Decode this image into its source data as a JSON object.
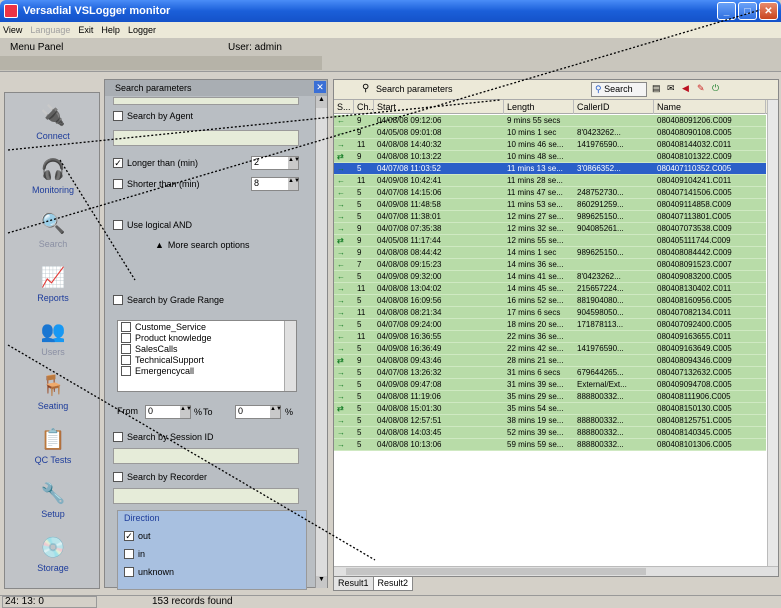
{
  "window": {
    "title": "Versadial VSLogger monitor"
  },
  "menu": {
    "items": [
      "View",
      "Language",
      "Exit",
      "Help",
      "Logger"
    ],
    "disabled": [
      1
    ]
  },
  "header": {
    "menu_panel": "Menu Panel",
    "user": "User: admin"
  },
  "sidebar": {
    "items": [
      {
        "label": "Connect",
        "icon": "plug-icon",
        "dim": false
      },
      {
        "label": "Monitoring",
        "icon": "headphones-icon",
        "dim": false
      },
      {
        "label": "Search",
        "icon": "magnifier-icon",
        "dim": true
      },
      {
        "label": "Reports",
        "icon": "chart-icon",
        "dim": false
      },
      {
        "label": "Users",
        "icon": "users-icon",
        "dim": true
      },
      {
        "label": "Seating",
        "icon": "seating-icon",
        "dim": false
      },
      {
        "label": "QC Tests",
        "icon": "clipboard-icon",
        "dim": false
      },
      {
        "label": "Setup",
        "icon": "tools-icon",
        "dim": false
      },
      {
        "label": "Storage",
        "icon": "disk-icon",
        "dim": false
      }
    ]
  },
  "search_panel": {
    "header": "Search parameters",
    "search_by_agent": "Search by Agent",
    "longer_than": "Longer than (min)",
    "longer_value": "2",
    "shorter_than": "Shorter than (min)",
    "shorter_value": "8",
    "use_logical_and": "Use logical AND",
    "more_options": "More search options",
    "search_by_grade": "Search by Grade Range",
    "grade_items": [
      "Custome_Service",
      "Product knowledge",
      "SalesCalls",
      "TechnicalSupport",
      "Emergencycall"
    ],
    "from_label": "From",
    "from_value": "0",
    "to_label": "To",
    "to_value": "0",
    "pct": "%",
    "search_by_session": "Search by Session ID",
    "search_by_recorder": "Search by Recorder",
    "direction_label": "Direction",
    "directions": [
      {
        "label": "out",
        "checked": true
      },
      {
        "label": "in",
        "checked": false
      },
      {
        "label": "unknown",
        "checked": false
      }
    ]
  },
  "results": {
    "toolbar_title": "Search parameters",
    "search_button": "Search",
    "columns": [
      "S...",
      "Ch...",
      "Start",
      "Length",
      "CallerID",
      "Name"
    ],
    "rows": [
      [
        "←",
        "9",
        "04/08/08 09:12:06",
        "9 mins 55 secs",
        "",
        "080408091206.C009"
      ],
      [
        "→",
        "9",
        "04/05/08 09:01:08",
        "10 mins 1 sec",
        "8'0423262...",
        "080408090108.C005"
      ],
      [
        "→",
        "11",
        "04/08/08 14:40:32",
        "10 mins 46 se...",
        "141976590...",
        "080408144032.C011"
      ],
      [
        "⇄",
        "9",
        "04/08/08 10:13:22",
        "10 mins 48 se...",
        "",
        "080408101322.C009"
      ],
      [
        "→",
        "5",
        "04/07/08 11:03:52",
        "11 mins 13 se...",
        "3'0866352...",
        "080407110352.C005"
      ],
      [
        "←",
        "11",
        "04/09/08 10:42:41",
        "11 mins 28 se...",
        "",
        "080409104241.C011"
      ],
      [
        "←",
        "5",
        "04/07/08 14:15:06",
        "11 mins 47 se...",
        "248752730...",
        "080407141506.C005"
      ],
      [
        "→",
        "5",
        "04/09/08 11:48:58",
        "11 mins 53 se...",
        "860291259...",
        "080409114858.C009"
      ],
      [
        "→",
        "5",
        "04/07/08 11:38:01",
        "12 mins 27 se...",
        "989625150...",
        "080407113801.C005"
      ],
      [
        "→",
        "9",
        "04/07/08 07:35:38",
        "12 mins 32 se...",
        "904085261...",
        "080407073538.C009"
      ],
      [
        "⇄",
        "9",
        "04/05/08 11:17:44",
        "12 mins 55 se...",
        "",
        "080405111744.C009"
      ],
      [
        "→",
        "9",
        "04/08/08 08:44:42",
        "14 mins 1 sec",
        "989625150...",
        "080408084442.C009"
      ],
      [
        "←",
        "7",
        "04/08/08 09:15:23",
        "14 mins 36 se...",
        "",
        "080408091523.C007"
      ],
      [
        "←",
        "5",
        "04/09/08 09:32:00",
        "14 mins 41 se...",
        "8'0423262...",
        "080409083200.C005"
      ],
      [
        "→",
        "11",
        "04/08/08 13:04:02",
        "14 mins 45 se...",
        "215657224...",
        "080408130402.C011"
      ],
      [
        "→",
        "5",
        "04/08/08 16:09:56",
        "16 mins 52 se...",
        "881904080...",
        "080408160956.C005"
      ],
      [
        "→",
        "11",
        "04/08/08 08:21:34",
        "17 mins 6 secs",
        "904598050...",
        "080407082134.C011"
      ],
      [
        "→",
        "5",
        "04/07/08 09:24:00",
        "18 mins 20 se...",
        "171878113...",
        "080407092400.C005"
      ],
      [
        "←",
        "11",
        "04/09/08 16:36:55",
        "22 mins 36 se...",
        "",
        "080409163655.C011"
      ],
      [
        "→",
        "5",
        "04/09/08 16:36:49",
        "22 mins 42 se...",
        "141976590...",
        "080409163649.C005"
      ],
      [
        "⇄",
        "9",
        "04/08/08 09:43:46",
        "28 mins 21 se...",
        "",
        "080408094346.C009"
      ],
      [
        "→",
        "5",
        "04/07/08 13:26:32",
        "31 mins 6 secs",
        "679644265...",
        "080407132632.C005"
      ],
      [
        "→",
        "5",
        "04/09/08 09:47:08",
        "31 mins 39 se...",
        "External/Ext...",
        "080409094708.C005"
      ],
      [
        "→",
        "5",
        "04/08/08 11:19:06",
        "35 mins 29 se...",
        "888800332...",
        "080408111906.C005"
      ],
      [
        "⇄",
        "5",
        "04/08/08 15:01:30",
        "35 mins 54 se...",
        "",
        "080408150130.C005"
      ],
      [
        "→",
        "5",
        "04/08/08 12:57:51",
        "38 mins 19 se...",
        "888800332...",
        "080408125751.C005"
      ],
      [
        "→",
        "5",
        "04/08/08 14:03:45",
        "52 mins 39 se...",
        "888800332...",
        "080408140345.C005"
      ],
      [
        "→",
        "5",
        "04/08/08 10:13:06",
        "59 mins 59 se...",
        "888800332...",
        "080408101306.C005"
      ]
    ],
    "selected_index": 4,
    "tabs": [
      "Result1",
      "Result2"
    ],
    "active_tab": 1
  },
  "status": {
    "time": "24: 13: 0",
    "records": "153 records found"
  }
}
